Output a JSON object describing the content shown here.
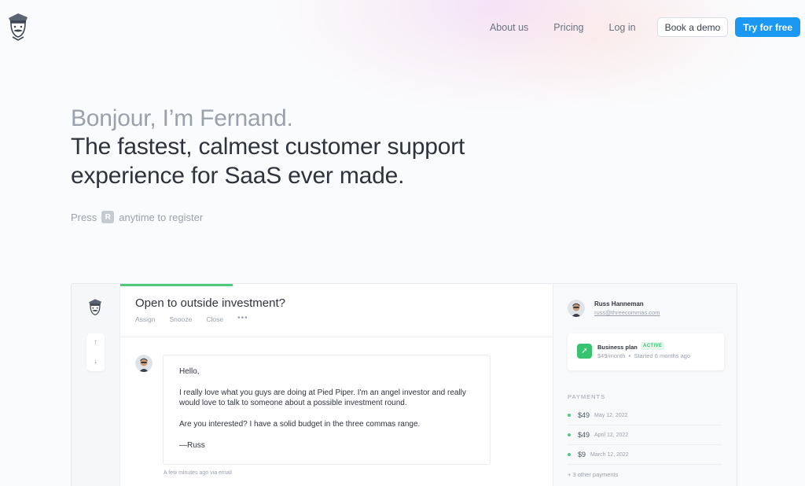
{
  "brand": {
    "logo_icon": "mascot-fernand-icon"
  },
  "nav": {
    "about": "About us",
    "pricing": "Pricing",
    "login": "Log in",
    "demo": "Book a demo",
    "try": "Try for free",
    "try_color": "#1a98f2"
  },
  "hero": {
    "greeting": "Bonjour, I’m Fernand.",
    "headline_1": "The fastest, calmest customer support",
    "headline_2": "experience for SaaS ever made.",
    "press_before": "Press",
    "press_key": "R",
    "press_after": "anytime to register"
  },
  "app": {
    "conversation": {
      "title": "Open to outside investment?",
      "actions": [
        "Assign",
        "Snooze",
        "Close",
        "•••"
      ],
      "progress_fraction": 0.26,
      "message": {
        "greeting": "Hello,",
        "body_1": "I really love what you guys are doing at Pied Piper. I'm an angel investor and really would love to talk to someone about a possible investment round.",
        "body_2": "Are you interested? I have a solid budget in the three commas range.",
        "signoff": "—Russ"
      },
      "meta": "A few minutes ago via email"
    },
    "customer": {
      "name": "Russ Hanneman",
      "email": "russ@threecommas.com",
      "plan": {
        "name": "Business plan",
        "badge": "ACTIVE",
        "price": "$49/month",
        "started": "Started 6 months ago"
      },
      "payments_heading": "PAYMENTS",
      "payments": [
        {
          "amount": "$49",
          "date": "May 12, 2022"
        },
        {
          "amount": "$49",
          "date": "April 12, 2022"
        },
        {
          "amount": "$9",
          "date": "March 12, 2022"
        }
      ],
      "more_payments": "+ 3 other payments"
    }
  },
  "colors": {
    "accent_green": "#37c36f",
    "accent_blue": "#1a98f2"
  }
}
